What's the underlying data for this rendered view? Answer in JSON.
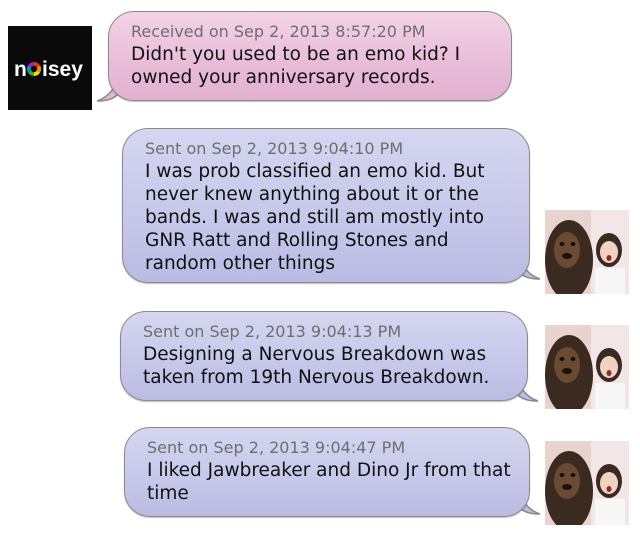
{
  "messages": [
    {
      "direction": "received",
      "meta": "Received on Sep 2, 2013 8:57:20 PM",
      "text": "Didn't you used to be an emo kid? I owned your anniversary records.",
      "avatar": "noisey-logo"
    },
    {
      "direction": "sent",
      "meta": "Sent on Sep 2, 2013 9:04:10 PM",
      "text": "I was prob classified an emo kid. But never knew anything about it or the bands. I was and still am mostly into GNR Ratt and Rolling Stones and random other things",
      "avatar": "chewbacca-leia-photo"
    },
    {
      "direction": "sent",
      "meta": "Sent on Sep 2, 2013 9:04:13 PM",
      "text": "Designing a Nervous Breakdown was taken from 19th Nervous Breakdown.",
      "avatar": "chewbacca-leia-photo"
    },
    {
      "direction": "sent",
      "meta": "Sent on Sep 2, 2013 9:04:47 PM",
      "text": "I liked Jawbreaker and Dino Jr from that time",
      "avatar": "chewbacca-leia-photo"
    }
  ],
  "logo": {
    "text_before": "n",
    "text_after": "isey",
    "background": "#0a0a0a",
    "text_color": "#ffffff"
  },
  "colors": {
    "received_bubble": "#e8bcd8",
    "sent_bubble": "#c6c7e9",
    "meta_text": "#6e6e6e",
    "message_text": "#111111"
  }
}
